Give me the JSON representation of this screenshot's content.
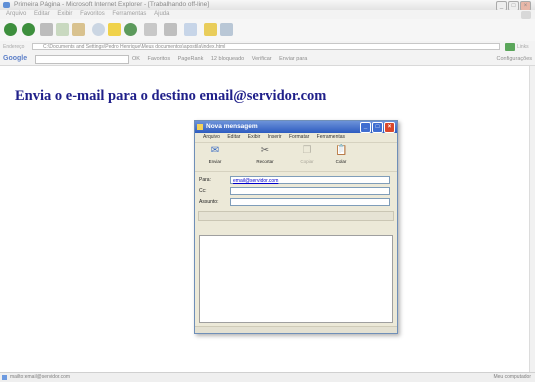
{
  "browser": {
    "title": "Primeira Página - Microsoft Internet Explorer - [Trabalhando off-line]",
    "menu": [
      "Arquivo",
      "Editar",
      "Exibir",
      "Favoritos",
      "Ferramentas",
      "Ajuda"
    ],
    "address_label": "Endereço",
    "address_value": "C:\\Documents and Settings\\Pedro Henrique\\Meus documentos\\apostila\\index.html",
    "links_label": "Links",
    "google_label": "Google",
    "google_items": [
      "OK",
      "Favoritos",
      "PageRank",
      "12 bloqueado",
      "Verificar",
      "Enviar para"
    ],
    "google_config": "Configurações"
  },
  "page": {
    "headline": "Envia o e-mail para o destino email@servidor.com"
  },
  "mail_window": {
    "title": "Nova mensagem",
    "menu": [
      "Arquivo",
      "Editar",
      "Exibir",
      "Inserir",
      "Formatar",
      "Ferramentas"
    ],
    "toolbar": [
      {
        "label": "Enviar",
        "icon": "send-icon",
        "enabled": true
      },
      {
        "label": "Recortar",
        "icon": "cut-icon",
        "enabled": true
      },
      {
        "label": "Copiar",
        "icon": "copy-icon",
        "enabled": false
      },
      {
        "label": "Colar",
        "icon": "paste-icon",
        "enabled": true
      }
    ],
    "to_label": "Para:",
    "to_value": "email@servidor.com",
    "cc_label": "Cc:",
    "cc_value": "",
    "subject_label": "Assunto:",
    "subject_value": ""
  },
  "status": {
    "left": "mailto:email@servidor.com",
    "right": "Meu computador"
  },
  "colors": {
    "headline": "#20208a",
    "mail_titlebar": "#2e5cc0"
  }
}
